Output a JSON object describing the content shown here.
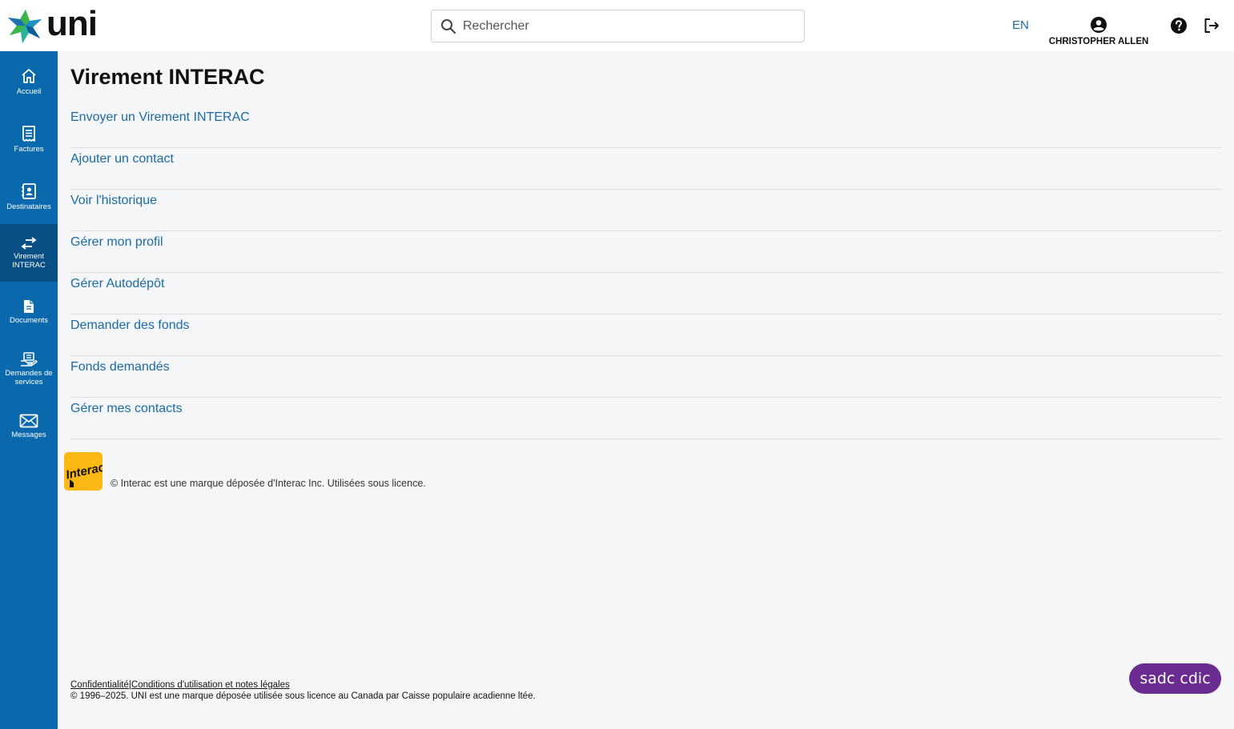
{
  "brand": {
    "logo_text": "uni"
  },
  "search": {
    "placeholder": "Rechercher"
  },
  "header": {
    "lang": "EN",
    "user_name": "CHRISTOPHER ALLEN"
  },
  "sidebar": {
    "items": [
      {
        "label": "Accueil",
        "icon": "home-icon"
      },
      {
        "label": "Factures",
        "icon": "receipt-icon"
      },
      {
        "label": "Destinataires",
        "icon": "contacts-icon"
      },
      {
        "label": "Virement INTERAC",
        "icon": "transfer-icon",
        "active": true
      },
      {
        "label": "Documents",
        "icon": "document-icon"
      },
      {
        "label": "Demandes de services",
        "icon": "service-request-icon"
      },
      {
        "label": "Messages",
        "icon": "envelope-icon"
      }
    ]
  },
  "main": {
    "title": "Virement INTERAC",
    "menu": [
      "Envoyer un Virement INTERAC",
      "Ajouter un contact",
      "Voir l'historique",
      "Gérer mon profil",
      "Gérer Autodépôt",
      "Demander des fonds",
      "Fonds demandés",
      "Gérer mes contacts"
    ],
    "interac_logo_text": "Interac",
    "interac_note": "© Interac est une marque déposée d'Interac Inc. Utilisées sous licence."
  },
  "footer": {
    "privacy": "Confidentialité",
    "separator": "|",
    "terms": "Conditions d'utilisation et notes légales",
    "copyright": "© 1996–2025. UNI est une marque déposée utilisée sous licence au Canada par Caisse populaire acadienne ltée.",
    "sadc": "sadc cdic"
  },
  "colors": {
    "sidebar": "#0a69ad",
    "sidebar_active": "#084f85",
    "link": "#1a6aa6",
    "interac": "#fdb913",
    "sadc": "#6a2c91"
  }
}
